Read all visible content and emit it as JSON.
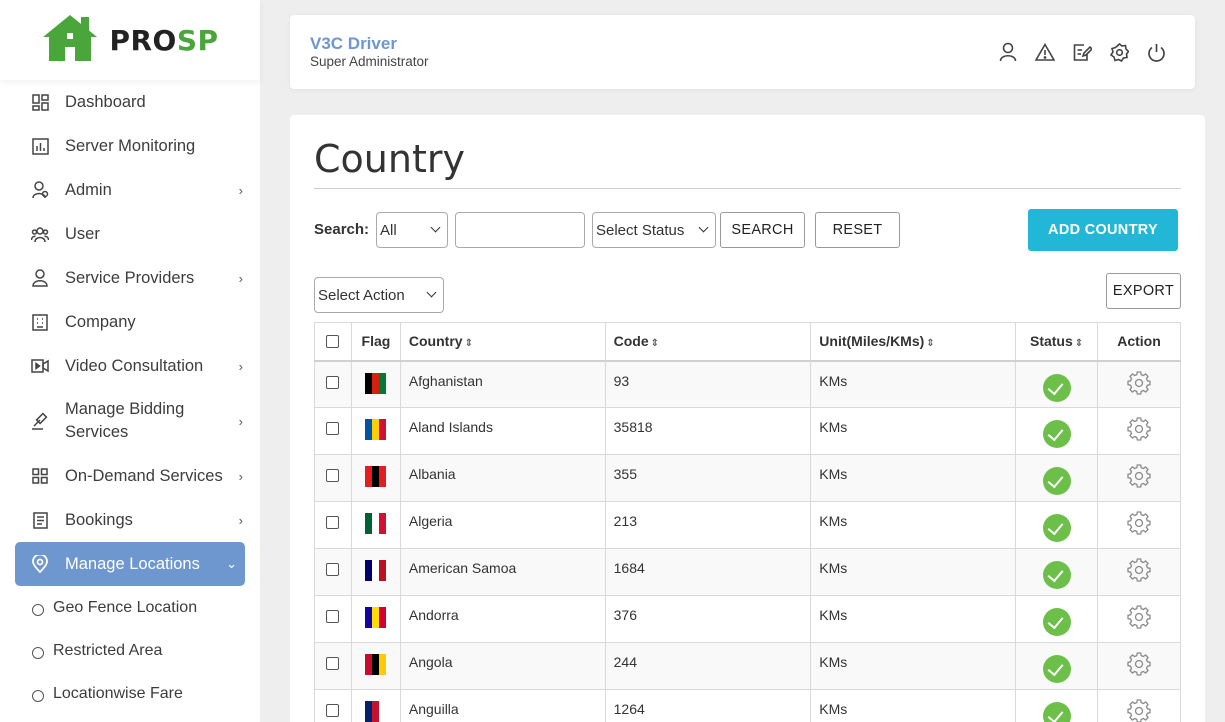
{
  "logo": {
    "part1": "PRO",
    "part2": "SP",
    "icon": "house-logo-icon"
  },
  "sidebar": {
    "items": [
      {
        "label": "Dashboard",
        "icon": "dashboard-icon",
        "has_chevron": false
      },
      {
        "label": "Server Monitoring",
        "icon": "bar-chart-icon",
        "has_chevron": false
      },
      {
        "label": "Admin",
        "icon": "admin-user-icon",
        "has_chevron": true
      },
      {
        "label": "User",
        "icon": "users-icon",
        "has_chevron": false
      },
      {
        "label": "Service Providers",
        "icon": "provider-icon",
        "has_chevron": true
      },
      {
        "label": "Company",
        "icon": "building-icon",
        "has_chevron": false
      },
      {
        "label": "Video Consultation",
        "icon": "video-icon",
        "has_chevron": true
      },
      {
        "label": "Manage Bidding Services",
        "icon": "gavel-icon",
        "has_chevron": true
      },
      {
        "label": "On-Demand Services",
        "icon": "grid-icon",
        "has_chevron": true
      },
      {
        "label": "Bookings",
        "icon": "document-icon",
        "has_chevron": true
      },
      {
        "label": "Manage Locations",
        "icon": "location-pin-icon",
        "has_chevron": true,
        "active": true
      }
    ],
    "subitems": [
      "Geo Fence Location",
      "Restricted Area",
      "Locationwise Fare"
    ]
  },
  "header": {
    "name": "V3C Driver",
    "role": "Super Administrator",
    "icons": [
      "profile-icon",
      "alert-icon",
      "edit-icon",
      "settings-icon",
      "power-icon"
    ]
  },
  "page": {
    "title": "Country",
    "search_label": "Search:",
    "search_field_value": "All",
    "search_input_value": "",
    "status_select_value": "Select Status",
    "search_button": "SEARCH",
    "reset_button": "RESET",
    "add_button": "ADD COUNTRY",
    "action_select_value": "Select Action",
    "export_button": "EXPORT"
  },
  "table": {
    "headers": {
      "flag": "Flag",
      "country": "Country",
      "code": "Code",
      "unit": "Unit(Miles/KMs)",
      "status": "Status",
      "action": "Action"
    },
    "rows": [
      {
        "country": "Afghanistan",
        "code": "93",
        "unit": "KMs",
        "flag_colors": [
          "#000000",
          "#d32011",
          "#007a36"
        ]
      },
      {
        "country": "Aland Islands",
        "code": "35818",
        "unit": "KMs",
        "flag_colors": [
          "#0053a5",
          "#ffce00",
          "#d21034"
        ]
      },
      {
        "country": "Albania",
        "code": "355",
        "unit": "KMs",
        "flag_colors": [
          "#e41e20",
          "#000000"
        ]
      },
      {
        "country": "Algeria",
        "code": "213",
        "unit": "KMs",
        "flag_colors": [
          "#006233",
          "#ffffff",
          "#d21034"
        ]
      },
      {
        "country": "American Samoa",
        "code": "1684",
        "unit": "KMs",
        "flag_colors": [
          "#000066",
          "#ffffff",
          "#bd1021"
        ]
      },
      {
        "country": "Andorra",
        "code": "376",
        "unit": "KMs",
        "flag_colors": [
          "#10069f",
          "#fedd00",
          "#d50032"
        ]
      },
      {
        "country": "Angola",
        "code": "244",
        "unit": "KMs",
        "flag_colors": [
          "#cc092f",
          "#000000",
          "#ffcb00"
        ]
      },
      {
        "country": "Anguilla",
        "code": "1264",
        "unit": "KMs",
        "flag_colors": [
          "#012169",
          "#c8102e",
          "#ffffff"
        ]
      }
    ]
  }
}
